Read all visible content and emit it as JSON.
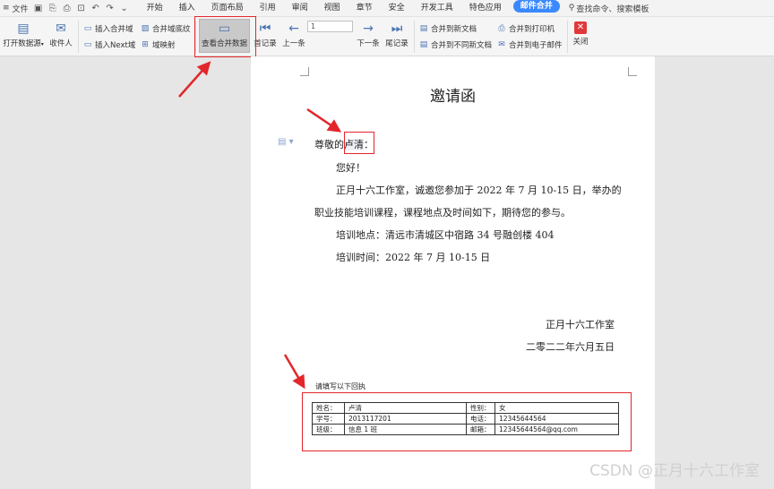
{
  "menubar": {
    "file_label": "文件",
    "tabs": [
      {
        "label": "开始",
        "active": false
      },
      {
        "label": "插入",
        "active": false
      },
      {
        "label": "页面布局",
        "active": false
      },
      {
        "label": "引用",
        "active": false
      },
      {
        "label": "审阅",
        "active": false
      },
      {
        "label": "视图",
        "active": false
      },
      {
        "label": "章节",
        "active": false
      },
      {
        "label": "安全",
        "active": false
      },
      {
        "label": "开发工具",
        "active": false
      },
      {
        "label": "特色应用",
        "active": false
      },
      {
        "label": "邮件合并",
        "active": true
      }
    ],
    "search_label": "查找命令、搜索模板"
  },
  "ribbon": {
    "open_source": "打开数据源",
    "recipients": "收件人",
    "insert_field": "插入合并域",
    "insert_next": "插入Next域",
    "merge_shading": "合并域底纹",
    "field_map": "域映射",
    "view_merged": "查看合并数据",
    "first_record": "首记录",
    "prev": "上一条",
    "record_value": "1",
    "next": "下一条",
    "last_record": "尾记录",
    "merge_new_doc": "合并到新文档",
    "merge_diff_docs": "合并到不同新文档",
    "merge_printer": "合并到打印机",
    "merge_email": "合并到电子邮件",
    "close": "关闭"
  },
  "document": {
    "title": "邀请函",
    "greeting_prefix": "尊敬的",
    "recipient_name": "卢清",
    "greeting_suffix": "：",
    "hello": "您好！",
    "body_line1": "正月十六工作室，诚邀您参加于 2022 年 7 月 10-15 日，举办的",
    "body_line2": "职业技能培训课程，课程地点及时间如下，期待您的参与。",
    "location": "培训地点：清远市清城区中宿路 34 号融创楼 404",
    "time": "培训时间：2022 年 7 月 10-15 日",
    "signature": "正月十六工作室",
    "date": "二零二二年六月五日",
    "reply_label": "请填写以下回执",
    "reply_rows": [
      [
        "姓名：",
        "卢清",
        "性别：",
        "女"
      ],
      [
        "学号：",
        "2013117201",
        "电话：",
        "12345644564"
      ],
      [
        "班级：",
        "信息 1 班",
        "邮箱：",
        "12345644564@qq.com"
      ]
    ]
  },
  "watermark": "CSDN @正月十六工作室",
  "colors": {
    "accent": "#3a89ff",
    "highlight": "#e3262b",
    "close": "#e0393b"
  }
}
